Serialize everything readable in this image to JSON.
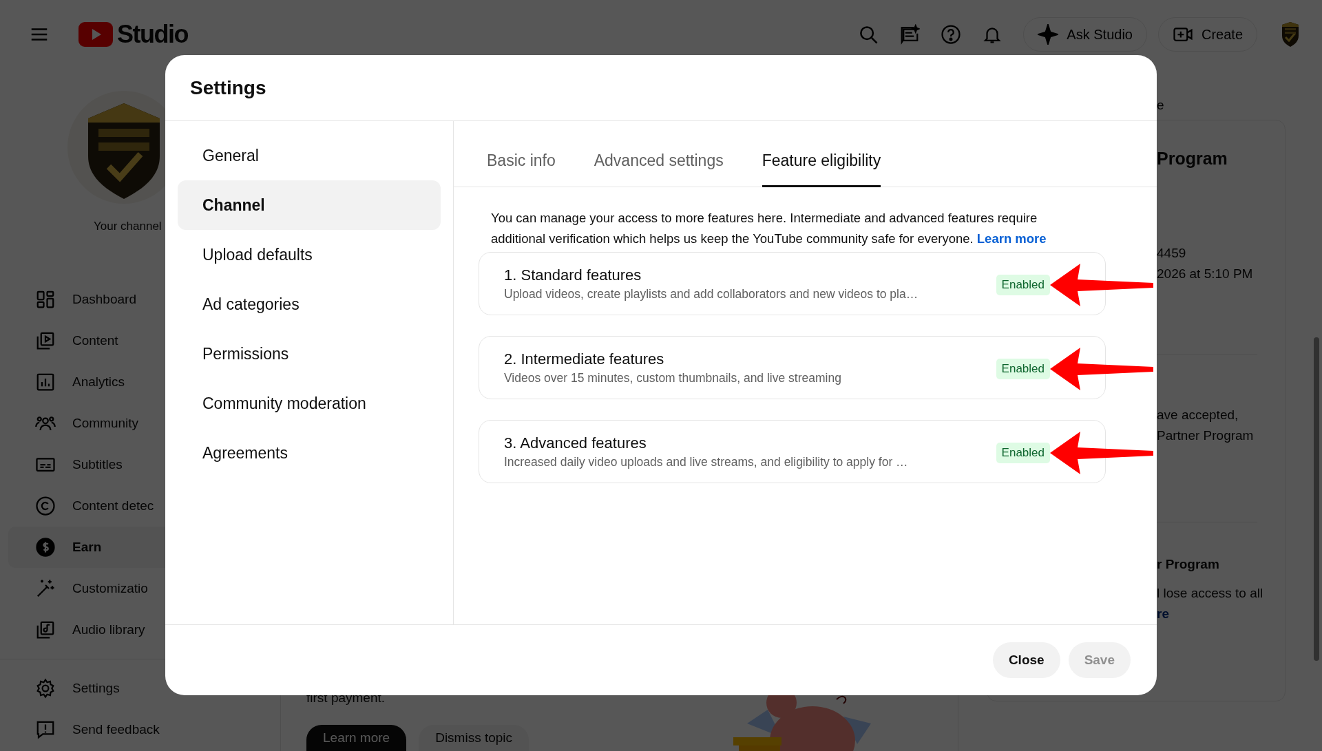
{
  "topbar": {
    "logo_text": "Studio",
    "ask_button": "Ask Studio",
    "create_button": "Create"
  },
  "sidebar": {
    "channel_label": "Your channel",
    "items": [
      {
        "label": "Dashboard",
        "selected": false
      },
      {
        "label": "Content",
        "selected": false
      },
      {
        "label": "Analytics",
        "selected": false
      },
      {
        "label": "Community",
        "selected": false
      },
      {
        "label": "Subtitles",
        "selected": false
      },
      {
        "label": "Content detec",
        "selected": false
      },
      {
        "label": "Earn",
        "selected": true
      },
      {
        "label": "Customizatio",
        "selected": false
      },
      {
        "label": "Audio library",
        "selected": false
      }
    ],
    "footer_items": [
      {
        "label": "Settings"
      },
      {
        "label": "Send feedback"
      }
    ]
  },
  "main": {
    "text": "first payment.",
    "buttons": [
      {
        "label": "Learn more",
        "kind": "primary"
      },
      {
        "label": "Dismiss topic",
        "kind": "secondary"
      }
    ]
  },
  "right_panel": {
    "top_text": "e",
    "sections": [
      {
        "heading": "Program",
        "lines": [
          "4459",
          "2026 at 5:10 PM"
        ]
      },
      {
        "lines": [
          "ave accepted,",
          "Partner Program"
        ]
      },
      {
        "heading": "r Program",
        "lines": [
          "l lose access to all"
        ],
        "link": "re"
      }
    ]
  },
  "dialog": {
    "title": "Settings",
    "nav": [
      {
        "label": "General",
        "selected": false
      },
      {
        "label": "Channel",
        "selected": true
      },
      {
        "label": "Upload defaults",
        "selected": false
      },
      {
        "label": "Ad categories",
        "selected": false
      },
      {
        "label": "Permissions",
        "selected": false
      },
      {
        "label": "Community moderation",
        "selected": false
      },
      {
        "label": "Agreements",
        "selected": false
      }
    ],
    "tabs": [
      {
        "label": "Basic info",
        "selected": false
      },
      {
        "label": "Advanced settings",
        "selected": false
      },
      {
        "label": "Feature eligibility",
        "selected": true
      }
    ],
    "intro": "You can manage your access to more features here. Intermediate and advanced features require additional verification which helps us keep the YouTube community safe for everyone.",
    "intro_link": "Learn more",
    "features": [
      {
        "title": "1. Standard features",
        "description": "Upload videos, create playlists and add collaborators and new videos to pla…",
        "status": "Enabled",
        "arrow": true
      },
      {
        "title": "2. Intermediate features",
        "description": "Videos over 15 minutes, custom thumbnails, and live streaming",
        "status": "Enabled",
        "arrow": true
      },
      {
        "title": "3. Advanced features",
        "description": "Increased daily video uploads and live streams, and eligibility to apply for …",
        "status": "Enabled",
        "arrow": true
      }
    ],
    "buttons": [
      {
        "label": "Close",
        "disabled": false
      },
      {
        "label": "Save",
        "disabled": true
      }
    ]
  }
}
